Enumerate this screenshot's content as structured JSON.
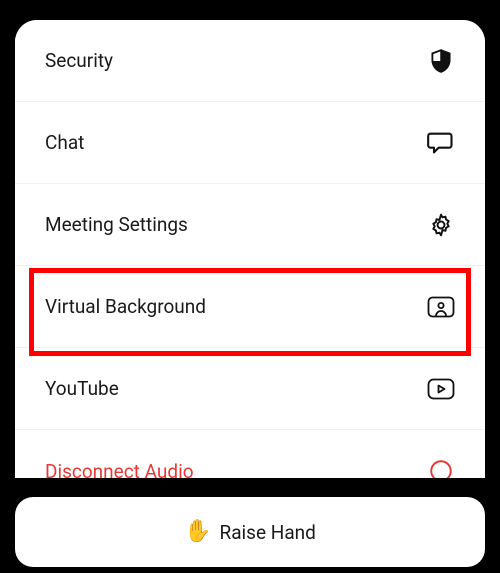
{
  "menu": {
    "items": [
      {
        "label": "Security",
        "icon": "shield-icon",
        "color": "default"
      },
      {
        "label": "Chat",
        "icon": "chat-bubble-icon",
        "color": "default"
      },
      {
        "label": "Meeting Settings",
        "icon": "gear-icon",
        "color": "default"
      },
      {
        "label": "Virtual Background",
        "icon": "virtual-background-icon",
        "color": "default",
        "highlighted": true
      },
      {
        "label": "YouTube",
        "icon": "youtube-icon",
        "color": "default"
      },
      {
        "label": "Disconnect Audio",
        "icon": "disconnect-audio-icon",
        "color": "red"
      }
    ]
  },
  "footer": {
    "raise_hand_emoji": "✋",
    "raise_hand_label": "Raise Hand"
  }
}
